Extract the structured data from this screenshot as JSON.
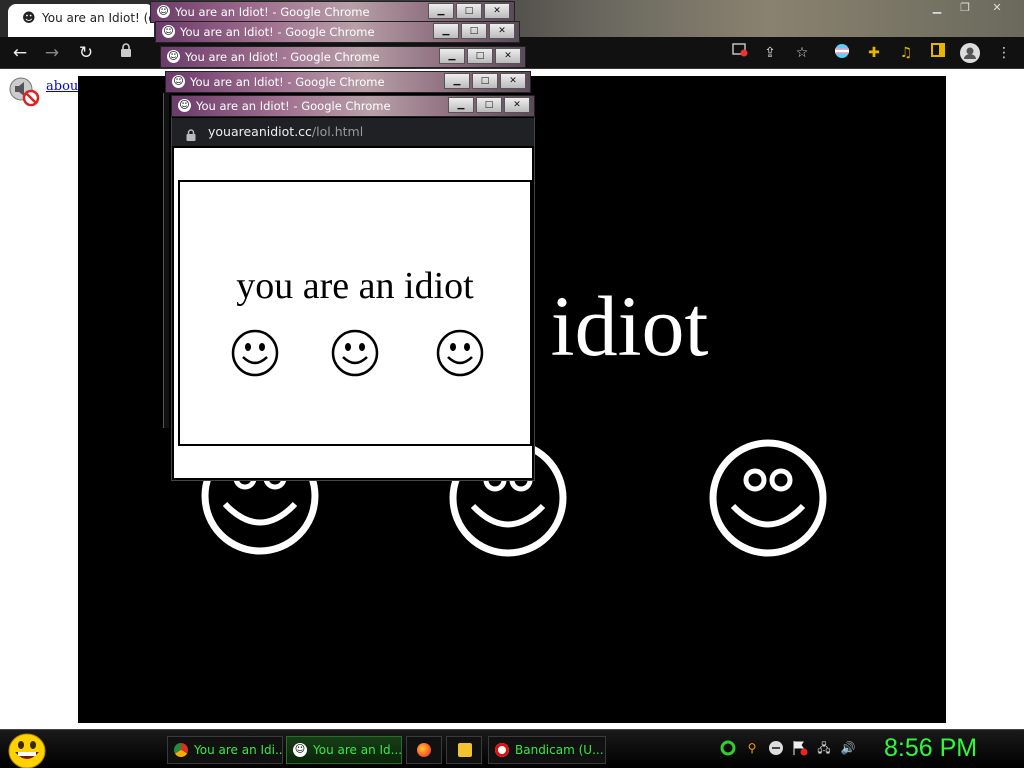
{
  "browser": {
    "tab_title": "You are an Idiot! (do",
    "tab_icon": "smiley-icon"
  },
  "page": {
    "about_link": "about:blank",
    "big_text": "an idiot"
  },
  "popups": [
    {
      "title": "You are an Idiot! - Google Chrome"
    },
    {
      "title": "You are an Idiot! - Google Chrome"
    },
    {
      "title": "You are an Idiot! - Google Chrome"
    },
    {
      "title": "You are an Idiot! - Google Chrome"
    },
    {
      "title": "You are an Idiot! - Google Chrome"
    }
  ],
  "popup": {
    "url_domain": "youareanidiot.cc",
    "url_path": "/lol.html",
    "text": "you are an idiot"
  },
  "taskbar": {
    "items": [
      {
        "label": "You are an Idi...",
        "icon": "chrome-icon"
      },
      {
        "label": "You are an Id...",
        "icon": "smiley-icon"
      },
      {
        "label": "",
        "icon": "firefox-icon"
      },
      {
        "label": "",
        "icon": "folder-icon"
      },
      {
        "label": "Bandicam (U...",
        "icon": "record-icon"
      }
    ],
    "clock": "8:56 PM"
  },
  "colors": {
    "taskbar_text": "#39e64a",
    "clock": "#2ef83c",
    "stage": "#000000"
  }
}
